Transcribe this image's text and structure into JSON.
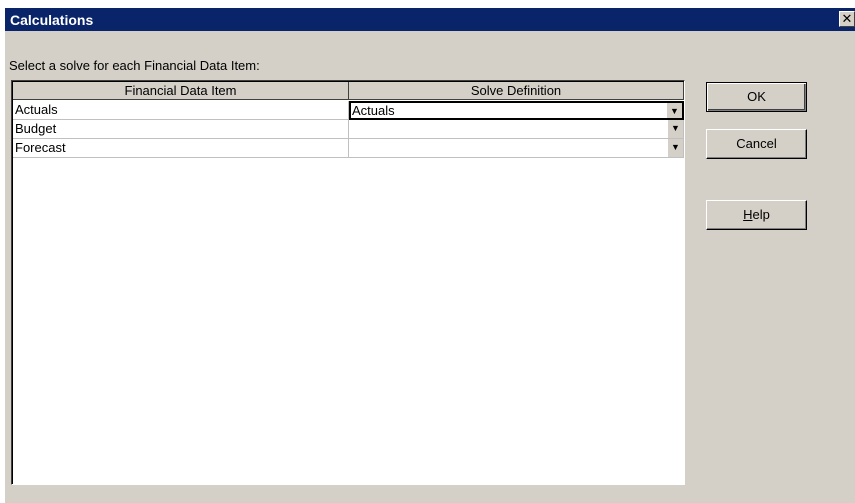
{
  "window": {
    "title": "Calculations",
    "close_glyph": "✕"
  },
  "instruction": "Select a solve for each Financial Data Item:",
  "grid": {
    "columns": [
      "Financial Data Item",
      "Solve Definition"
    ],
    "rows": [
      {
        "item": "Actuals",
        "solve": "Actuals"
      },
      {
        "item": "Budget",
        "solve": ""
      },
      {
        "item": "Forecast",
        "solve": ""
      }
    ]
  },
  "buttons": {
    "ok": "OK",
    "cancel": "Cancel",
    "help_mnemonic": "H",
    "help_rest": "elp"
  },
  "colors": {
    "titlebar": "#0a246a",
    "face": "#d4d0c8"
  }
}
